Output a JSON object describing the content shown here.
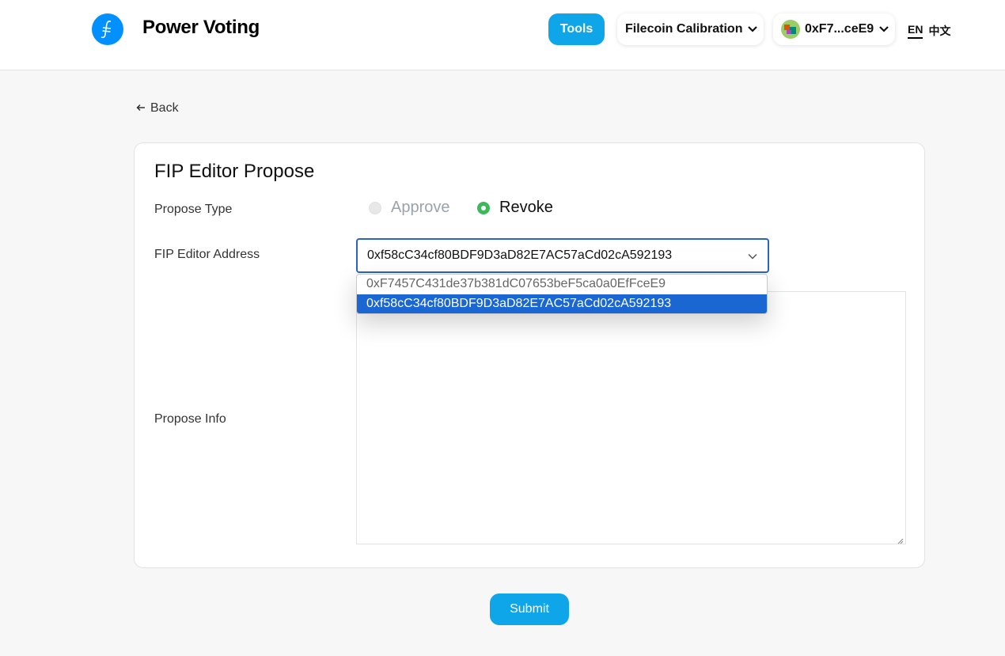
{
  "header": {
    "brand": "Power Voting",
    "tools_label": "Tools",
    "network_label": "Filecoin Calibration",
    "account_label": "0xF7...ceE9",
    "lang_en": "EN",
    "lang_zh": "中文"
  },
  "back_label": "Back",
  "form": {
    "title": "FIP Editor Propose",
    "propose_type_label": "Propose Type",
    "radio_options": [
      {
        "label": "Approve",
        "checked": false
      },
      {
        "label": "Revoke",
        "checked": true
      }
    ],
    "address_label": "FIP Editor Address",
    "selected_address": "0xf58cC34cf80BDF9D3aD82E7AC57aCd02cA592193",
    "address_options": [
      "0xF7457C431de37b381dC07653beF5ca0a0EfFceE9",
      "0xf58cC34cf80BDF9D3aD82E7AC57aCd02cA592193"
    ],
    "info_label": "Propose Info",
    "info_value": ""
  },
  "submit_label": "Submit",
  "colors": {
    "accent": "#0ea5e9",
    "select_border": "#2a62c9",
    "option_selected": "#1a66d2",
    "radio_checked": "#3db85a"
  },
  "icons": [
    "filecoin-logo-icon",
    "chevron-down-icon",
    "avatar-icon",
    "arrow-left-icon",
    "resize-handle-icon"
  ]
}
